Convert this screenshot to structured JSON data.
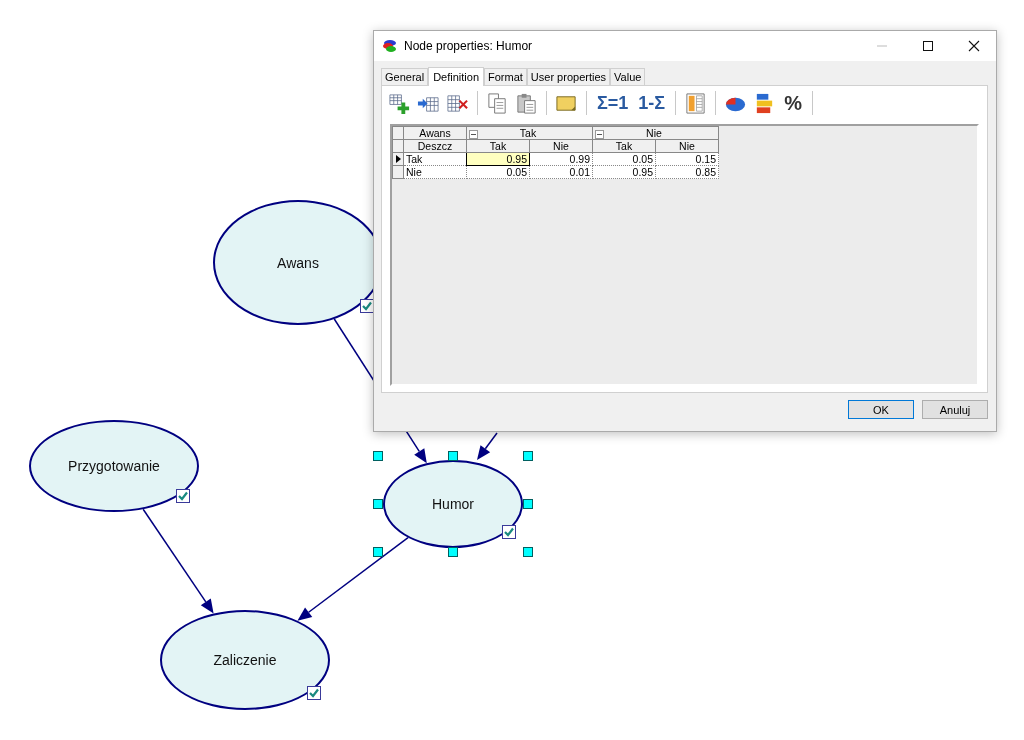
{
  "canvas": {
    "nodes": [
      {
        "label": "Awans",
        "checked": true,
        "selected": false
      },
      {
        "label": "Przygotowanie",
        "checked": true,
        "selected": false
      },
      {
        "label": "Humor",
        "checked": true,
        "selected": true
      },
      {
        "label": "Zaliczenie",
        "checked": true,
        "selected": false
      }
    ]
  },
  "dialog": {
    "title": "Node properties: Humor",
    "tabs": [
      {
        "label": "General",
        "selected": false
      },
      {
        "label": "Definition",
        "selected": true
      },
      {
        "label": "Format",
        "selected": false
      },
      {
        "label": "User properties",
        "selected": false
      },
      {
        "label": "Value",
        "selected": false
      }
    ],
    "toolbar": {
      "labels": [
        "Σ=1",
        "1-Σ",
        "%"
      ]
    },
    "table": {
      "parent": {
        "name": "Awans",
        "groups": [
          {
            "label": "Tak",
            "expanded": true
          },
          {
            "label": "Nie",
            "expanded": true
          }
        ]
      },
      "child": {
        "name": "Deszcz",
        "states": [
          "Tak",
          "Nie",
          "Tak",
          "Nie"
        ]
      },
      "rows": [
        {
          "label": "Tak",
          "selected": true,
          "cells": [
            {
              "value": "0.95",
              "selected": true
            },
            {
              "value": "0.99",
              "selected": false
            },
            {
              "value": "0.05",
              "selected": false
            },
            {
              "value": "0.15",
              "selected": false
            }
          ]
        },
        {
          "label": "Nie",
          "selected": false,
          "cells": [
            {
              "value": "0.05",
              "selected": false
            },
            {
              "value": "0.01",
              "selected": false
            },
            {
              "value": "0.95",
              "selected": false
            },
            {
              "value": "0.85",
              "selected": false
            }
          ]
        }
      ]
    },
    "buttons": [
      {
        "label": "OK",
        "default": true
      },
      {
        "label": "Anuluj",
        "default": false
      }
    ]
  }
}
